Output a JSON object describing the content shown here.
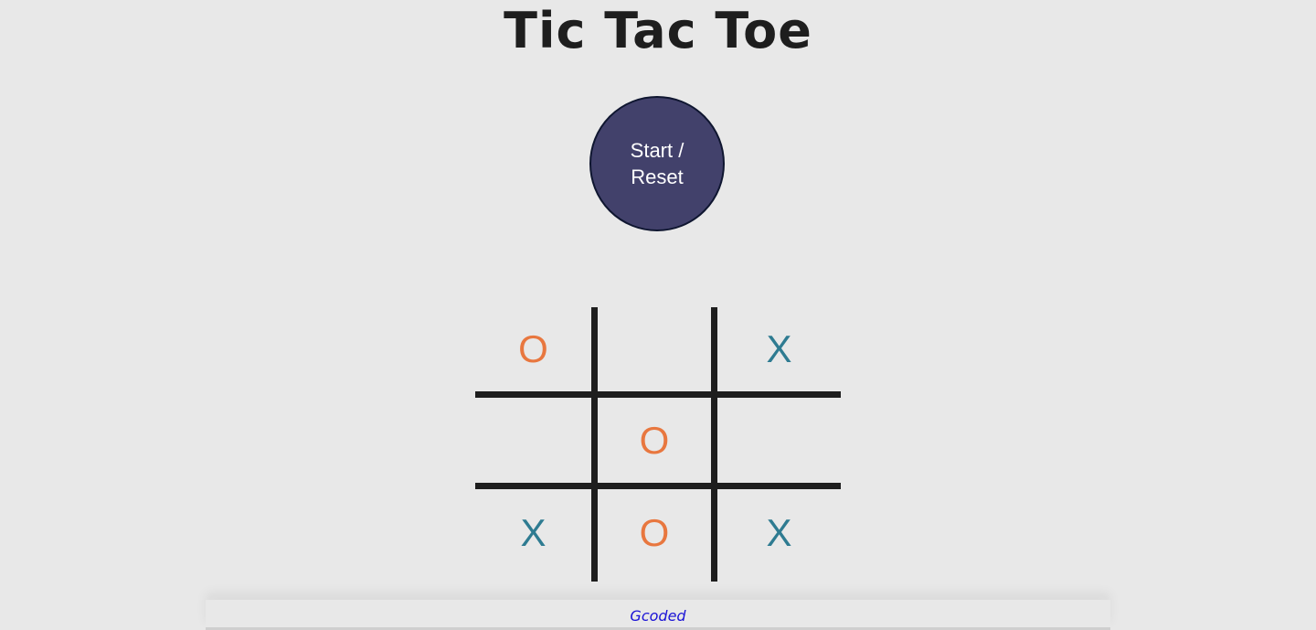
{
  "header": {
    "title": "Tic Tac Toe"
  },
  "controls": {
    "start_reset_label": "Start / Reset"
  },
  "board": {
    "cells": [
      "O",
      "",
      "X",
      "",
      "O",
      "",
      "X",
      "O",
      "X"
    ]
  },
  "footer": {
    "credit": "Gcoded"
  },
  "colors": {
    "o_mark": "#e8773f",
    "x_mark": "#2e7b91",
    "button_bg": "#42416b",
    "credit_link": "#1a12d6"
  }
}
